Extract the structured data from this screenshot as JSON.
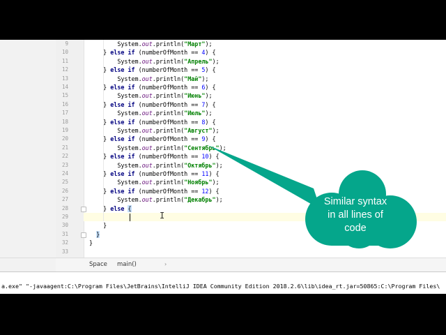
{
  "editor": {
    "lines": [
      {
        "no": "9",
        "parts": [
          [
            "",
            "        System."
          ],
          [
            "fld",
            "out"
          ],
          [
            "",
            ".println("
          ],
          [
            "str",
            "\"Март\""
          ],
          [
            "",
            ");"
          ]
        ]
      },
      {
        "no": "10",
        "parts": [
          [
            "",
            "    } "
          ],
          [
            "kw",
            "else if"
          ],
          [
            "",
            " (numberOfMonth == "
          ],
          [
            "num",
            "4"
          ],
          [
            "",
            ") {"
          ]
        ]
      },
      {
        "no": "11",
        "parts": [
          [
            "",
            "        System."
          ],
          [
            "fld",
            "out"
          ],
          [
            "",
            ".println("
          ],
          [
            "str",
            "\"Апрель\""
          ],
          [
            "",
            ");"
          ]
        ]
      },
      {
        "no": "12",
        "parts": [
          [
            "",
            "    } "
          ],
          [
            "kw",
            "else if"
          ],
          [
            "",
            " (numberOfMonth == "
          ],
          [
            "num",
            "5"
          ],
          [
            "",
            ") {"
          ]
        ]
      },
      {
        "no": "13",
        "parts": [
          [
            "",
            "        System."
          ],
          [
            "fld",
            "out"
          ],
          [
            "",
            ".println("
          ],
          [
            "str",
            "\"Май\""
          ],
          [
            "",
            ");"
          ]
        ]
      },
      {
        "no": "14",
        "parts": [
          [
            "",
            "    } "
          ],
          [
            "kw",
            "else if"
          ],
          [
            "",
            " (numberOfMonth == "
          ],
          [
            "num",
            "6"
          ],
          [
            "",
            ") {"
          ]
        ]
      },
      {
        "no": "15",
        "parts": [
          [
            "",
            "        System."
          ],
          [
            "fld",
            "out"
          ],
          [
            "",
            ".println("
          ],
          [
            "str",
            "\"Июнь\""
          ],
          [
            "",
            ");"
          ]
        ]
      },
      {
        "no": "16",
        "parts": [
          [
            "",
            "    } "
          ],
          [
            "kw",
            "else if"
          ],
          [
            "",
            " (numberOfMonth == "
          ],
          [
            "num",
            "7"
          ],
          [
            "",
            ") {"
          ]
        ]
      },
      {
        "no": "17",
        "parts": [
          [
            "",
            "        System."
          ],
          [
            "fld",
            "out"
          ],
          [
            "",
            ".println("
          ],
          [
            "str",
            "\"Июль\""
          ],
          [
            "",
            ");"
          ]
        ]
      },
      {
        "no": "18",
        "parts": [
          [
            "",
            "    } "
          ],
          [
            "kw",
            "else if"
          ],
          [
            "",
            " (numberOfMonth == "
          ],
          [
            "num",
            "8"
          ],
          [
            "",
            ") {"
          ]
        ]
      },
      {
        "no": "19",
        "parts": [
          [
            "",
            "        System."
          ],
          [
            "fld",
            "out"
          ],
          [
            "",
            ".println("
          ],
          [
            "str",
            "\"Август\""
          ],
          [
            "",
            ");"
          ]
        ]
      },
      {
        "no": "20",
        "parts": [
          [
            "",
            "    } "
          ],
          [
            "kw",
            "else if"
          ],
          [
            "",
            " (numberOfMonth == "
          ],
          [
            "num",
            "9"
          ],
          [
            "",
            ") {"
          ]
        ]
      },
      {
        "no": "21",
        "parts": [
          [
            "",
            "        System."
          ],
          [
            "fld",
            "out"
          ],
          [
            "",
            ".println("
          ],
          [
            "str",
            "\"Сентябрь\""
          ],
          [
            "",
            ");"
          ]
        ]
      },
      {
        "no": "22",
        "parts": [
          [
            "",
            "    } "
          ],
          [
            "kw",
            "else if"
          ],
          [
            "",
            " (numberOfMonth == "
          ],
          [
            "num",
            "10"
          ],
          [
            "",
            ") {"
          ]
        ]
      },
      {
        "no": "23",
        "parts": [
          [
            "",
            "        System."
          ],
          [
            "fld",
            "out"
          ],
          [
            "",
            ".println("
          ],
          [
            "str",
            "\"Октябрь\""
          ],
          [
            "",
            ");"
          ]
        ]
      },
      {
        "no": "24",
        "parts": [
          [
            "",
            "    } "
          ],
          [
            "kw",
            "else if"
          ],
          [
            "",
            " (numberOfMonth == "
          ],
          [
            "num",
            "11"
          ],
          [
            "",
            ") {"
          ]
        ]
      },
      {
        "no": "25",
        "parts": [
          [
            "",
            "        System."
          ],
          [
            "fld",
            "out"
          ],
          [
            "",
            ".println("
          ],
          [
            "str",
            "\"Ноябрь\""
          ],
          [
            "",
            ");"
          ]
        ]
      },
      {
        "no": "26",
        "parts": [
          [
            "",
            "    } "
          ],
          [
            "kw",
            "else if"
          ],
          [
            "",
            " (numberOfMonth == "
          ],
          [
            "num",
            "12"
          ],
          [
            "",
            ") {"
          ]
        ]
      },
      {
        "no": "27",
        "parts": [
          [
            "",
            "        System."
          ],
          [
            "fld",
            "out"
          ],
          [
            "",
            ".println("
          ],
          [
            "str",
            "\"Декабрь\""
          ],
          [
            "",
            ");"
          ]
        ]
      },
      {
        "no": "28",
        "parts": [
          [
            "",
            "    } "
          ],
          [
            "kw",
            "else"
          ],
          [
            "",
            " "
          ],
          [
            "brace",
            "{"
          ]
        ]
      },
      {
        "no": "29",
        "parts": [
          [
            "",
            "        "
          ]
        ]
      },
      {
        "no": "30",
        "parts": [
          [
            "",
            "    }"
          ]
        ]
      },
      {
        "no": "31",
        "parts": [
          [
            "",
            "  "
          ],
          [
            "brace",
            "}"
          ]
        ]
      },
      {
        "no": "32",
        "parts": [
          [
            "",
            "}"
          ]
        ]
      },
      {
        "no": "33",
        "parts": [
          [
            "",
            ""
          ]
        ]
      }
    ]
  },
  "breadcrumb": {
    "items": [
      "Space",
      "main()"
    ]
  },
  "console": {
    "line": "a.exe\" \"-javaagent:C:\\Program Files\\JetBrains\\IntelliJ IDEA Community Edition 2018.2.6\\lib\\idea_rt.jar=50865:C:\\Program Files\\"
  },
  "callout": {
    "text_lines": [
      "Similar syntax",
      "in all lines of",
      "code"
    ],
    "color": "#05a68b"
  },
  "colors": {
    "keyword": "#000080",
    "string": "#008000",
    "number": "#0000ff",
    "field": "#660e7a",
    "current_line": "#fffde3"
  }
}
